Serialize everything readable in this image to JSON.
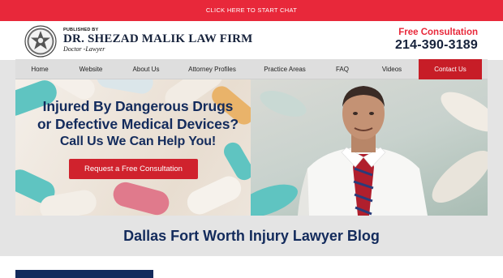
{
  "chatbar": {
    "label": "CLICK HERE TO START CHAT"
  },
  "header": {
    "published_by": "PUBLISHED BY",
    "firm_name": "DR. SHEZAD MALIK LAW FIRM",
    "tagline": "Doctor -Lawyer",
    "consult_label": "Free Consultation",
    "phone": "214-390-3189"
  },
  "nav": {
    "items": [
      {
        "label": "Home"
      },
      {
        "label": "Website"
      },
      {
        "label": "About Us"
      },
      {
        "label": "Attorney Profiles"
      },
      {
        "label": "Practice Areas"
      },
      {
        "label": "FAQ"
      },
      {
        "label": "Videos"
      },
      {
        "label": "Contact Us"
      }
    ],
    "active": "Contact Us"
  },
  "hero": {
    "line1": "Injured By Dangerous Drugs",
    "line2": "or Defective Medical Devices?",
    "line3": "Call Us We Can Help You!",
    "button": "Request a Free Consultation"
  },
  "blog": {
    "title": "Dallas Fort Worth Injury Lawyer Blog"
  },
  "colors": {
    "accent_red": "#e8283a",
    "button_red": "#d0222d",
    "navy": "#132b5c"
  },
  "icons": {
    "logo": "sheriff-star-seal-icon"
  }
}
